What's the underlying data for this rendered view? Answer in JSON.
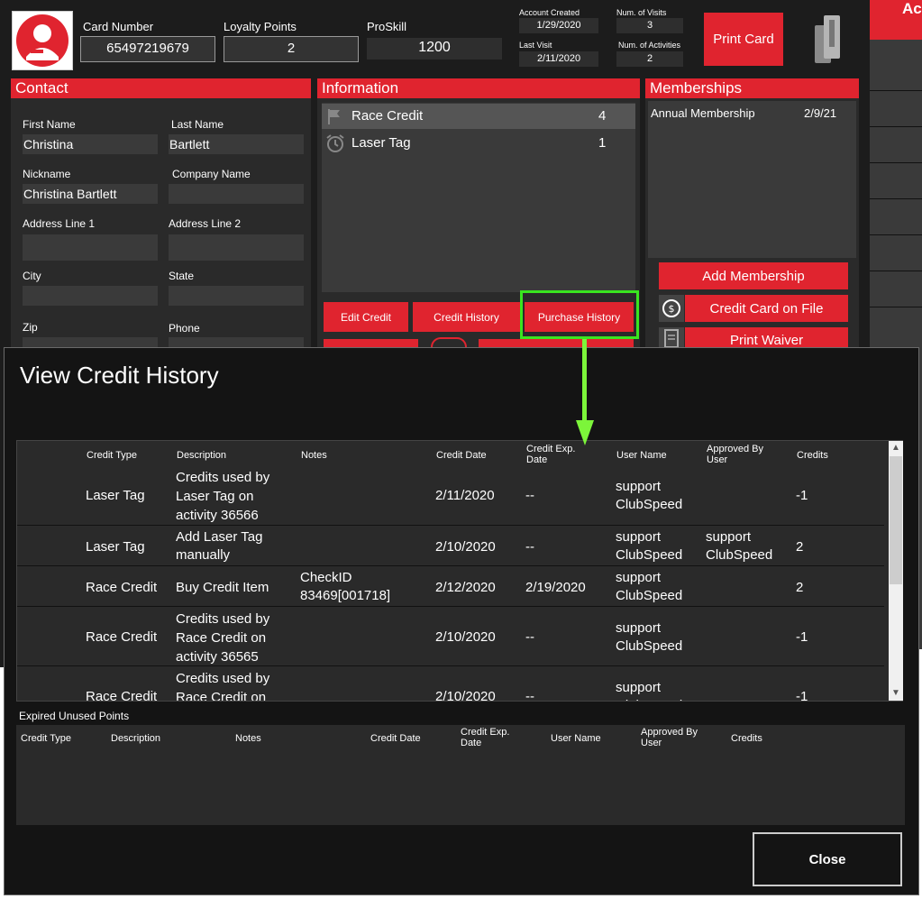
{
  "header": {
    "card_number_label": "Card Number",
    "card_number": "65497219679",
    "loyalty_label": "Loyalty Points",
    "loyalty_points": "2",
    "proskill_label": "ProSkill",
    "proskill": "1200",
    "account_created_label": "Account Created",
    "account_created": "1/29/2020",
    "last_visit_label": "Last Visit",
    "last_visit": "2/11/2020",
    "num_visits_label": "Num. of Visits",
    "num_visits": "3",
    "num_activities_label": "Num. of Activities",
    "num_activities": "2",
    "print_card": "Print  Card",
    "right_tab": "Ac"
  },
  "contact": {
    "title": "Contact",
    "first_name_label": "First Name",
    "first_name": "Christina",
    "last_name_label": "Last Name",
    "last_name": "Bartlett",
    "nickname_label": "Nickname",
    "nickname": "Christina Bartlett",
    "company_label": "Company Name",
    "company": "",
    "address1_label": "Address Line 1",
    "address2_label": "Address Line 2",
    "city_label": "City",
    "state_label": "State",
    "zip_label": "Zip",
    "phone_label": "Phone"
  },
  "information": {
    "title": "Information",
    "items": [
      {
        "label": "Race Credit",
        "count": "4",
        "icon": "flag-icon"
      },
      {
        "label": "Laser Tag",
        "count": "1",
        "icon": "alarm-clock-icon"
      }
    ],
    "edit_credit": "Edit Credit",
    "credit_history": "Credit History",
    "purchase_history": "Purchase History"
  },
  "memberships": {
    "title": "Memberships",
    "items": [
      {
        "name": "Annual Membership",
        "date": "2/9/21"
      }
    ],
    "add_membership": "Add Membership",
    "credit_card_on_file": "Credit Card on File",
    "print_waiver": "Print Waiver"
  },
  "modal": {
    "title": "View Credit History",
    "columns": [
      "Credit Type",
      "Description",
      "Notes",
      "Credit Date",
      "Credit Exp.\nDate",
      "User Name",
      "Approved By\nUser",
      "Credits"
    ],
    "rows": [
      {
        "type": "Laser Tag",
        "description": "Credits used by\nLaser Tag on\nactivity 36566",
        "notes": "",
        "date": "2/11/2020",
        "exp": "--",
        "user": "support\nClubSpeed",
        "approved": "",
        "credits": "-1"
      },
      {
        "type": "Laser Tag",
        "description": "Add Laser Tag\nmanually",
        "notes": "",
        "date": "2/10/2020",
        "exp": "--",
        "user": "support\nClubSpeed",
        "approved": "support\nClubSpeed",
        "credits": "2"
      },
      {
        "type": "Race Credit",
        "description": "Buy Credit Item",
        "notes": "CheckID\n83469[001718]",
        "date": "2/12/2020",
        "exp": "2/19/2020",
        "user": "support\nClubSpeed",
        "approved": "",
        "credits": "2"
      },
      {
        "type": "Race Credit",
        "description": "Credits used by\nRace Credit on\nactivity 36565",
        "notes": "",
        "date": "2/10/2020",
        "exp": "--",
        "user": "support\nClubSpeed",
        "approved": "",
        "credits": "-1"
      },
      {
        "type": "Race Credit",
        "description": "Credits used by\nRace Credit on",
        "notes": "",
        "date": "2/10/2020",
        "exp": "--",
        "user": "support\nClubSpeed",
        "approved": "",
        "credits": "-1"
      }
    ],
    "expired_label": "Expired Unused Points",
    "expired_columns": [
      "Credit Type",
      "Description",
      "Notes",
      "Credit Date",
      "Credit Exp.\nDate",
      "User Name",
      "Approved By\nUser",
      "Credits"
    ],
    "close": "Close"
  },
  "colors": {
    "accent": "#e0242f",
    "highlight": "#39e51f"
  }
}
